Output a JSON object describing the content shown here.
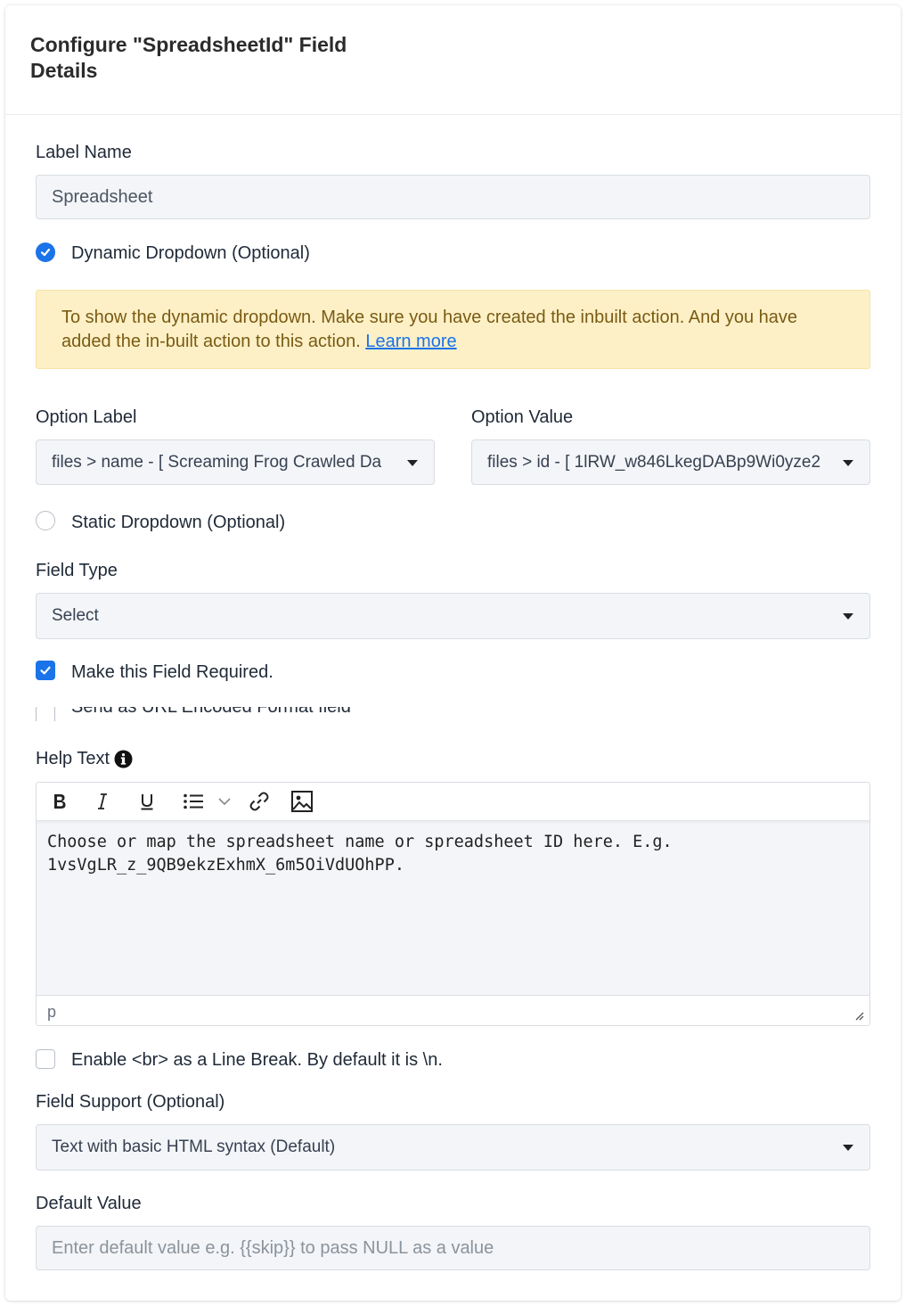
{
  "header": {
    "title": "Configure \"SpreadsheetId\" Field Details"
  },
  "label_name": {
    "label": "Label Name",
    "value": "Spreadsheet"
  },
  "dynamic_dropdown": {
    "label": "Dynamic Dropdown (Optional)",
    "selected": true
  },
  "alert": {
    "text": "To show the dynamic dropdown. Make sure you have created the inbuilt action. And you have added the in-built action to this action. ",
    "link": "Learn more"
  },
  "option_label": {
    "label": "Option Label",
    "value": "files > name - [ Screaming Frog Crawled Da"
  },
  "option_value": {
    "label": "Option Value",
    "value": "files > id - [ 1lRW_w846LkegDABp9Wi0yze2"
  },
  "static_dropdown": {
    "label": "Static Dropdown (Optional)",
    "selected": false
  },
  "field_type": {
    "label": "Field Type",
    "value": "Select"
  },
  "make_required": {
    "label": "Make this Field Required.",
    "checked": true
  },
  "url_encoded": {
    "label": "Send as URL Encoded Format field",
    "checked": false
  },
  "help_text": {
    "label": "Help Text",
    "info_icon": "info-icon",
    "toolbar": [
      "bold-icon",
      "italic-icon",
      "underline-icon",
      "bullet-list-icon",
      "chevron-down-icon",
      "link-icon",
      "image-icon"
    ],
    "content_line1": "Choose or map the spreadsheet name or spreadsheet ID here. E.g.",
    "content_line2": "1vsVgLR_z_9QB9ekzExhmX_6m5OiVdUOhPP.",
    "status": "p"
  },
  "line_break": {
    "label": "Enable <br> as a Line Break. By default it is \\n.",
    "checked": false
  },
  "field_support": {
    "label": "Field Support (Optional)",
    "value": "Text with basic HTML syntax (Default)"
  },
  "default_value": {
    "label": "Default Value",
    "placeholder": "Enter default value e.g. {{skip}} to pass NULL as a value",
    "value": ""
  },
  "colors": {
    "accent": "#1a73e8",
    "alert_bg": "#fdf0c7",
    "alert_text": "#7a5b13",
    "input_bg": "#f3f5f8"
  }
}
